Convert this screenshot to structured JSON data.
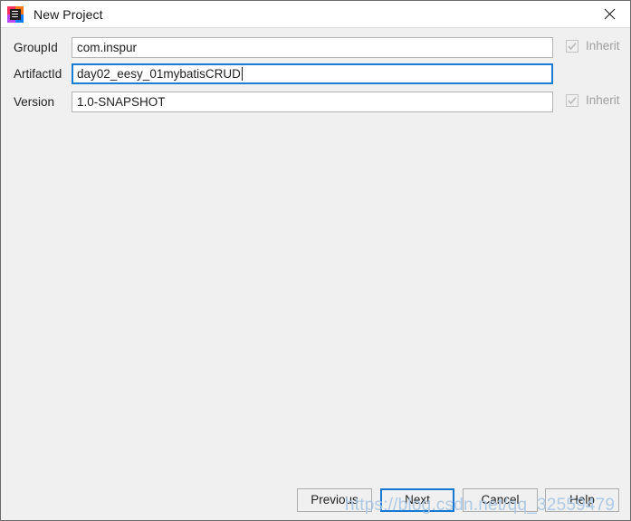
{
  "window": {
    "title": "New Project",
    "icon": "intellij-idea-icon",
    "close_label": "✕",
    "background_color": "#f0f0f0",
    "titlebar_color": "#ffffff",
    "accent_color": "#1678d2"
  },
  "form": {
    "rows": [
      {
        "label": "GroupId",
        "value": "com.inspur",
        "focused": false,
        "inherit": {
          "label": "Inherit",
          "checked": true,
          "disabled": true
        }
      },
      {
        "label": "ArtifactId",
        "value": "day02_eesy_01mybatisCRUD",
        "focused": true,
        "inherit": null
      },
      {
        "label": "Version",
        "value": "1.0-SNAPSHOT",
        "focused": false,
        "inherit": {
          "label": "Inherit",
          "checked": true,
          "disabled": true
        }
      }
    ]
  },
  "buttons": {
    "previous": "Previous",
    "next": "Next",
    "cancel": "Cancel",
    "help": "Help"
  },
  "watermark": {
    "text": "https://blog.csdn.net/qq_32559479",
    "color": "#aac7e4"
  }
}
